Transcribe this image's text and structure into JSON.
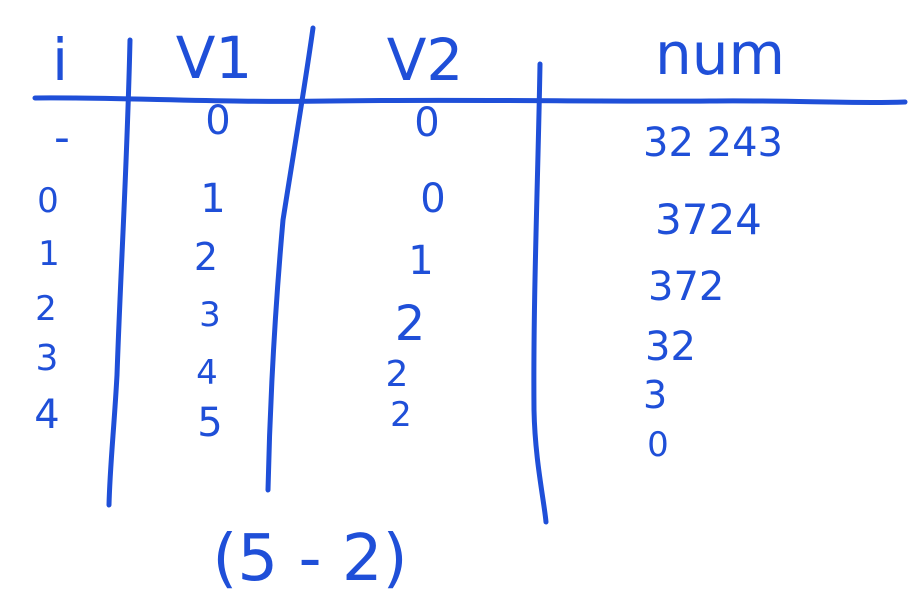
{
  "ink_color": "#1f4fd8",
  "headers": [
    "i",
    "V1",
    "V2",
    "num"
  ],
  "rows": [
    {
      "i": "-",
      "v1": "0",
      "v2": "0",
      "num": "32 243"
    },
    {
      "i": "0",
      "v1": "1",
      "v2": "0",
      "num": "3724"
    },
    {
      "i": "1",
      "v1": "2",
      "v2": "1",
      "num": "372"
    },
    {
      "i": "2",
      "v1": "3",
      "v2": "2",
      "num": "32"
    },
    {
      "i": "3",
      "v1": "4",
      "v2": "2",
      "num": "3"
    },
    {
      "i": "4",
      "v1": "5",
      "v2": "2",
      "num": "0"
    }
  ],
  "footer": "(5 - 2)"
}
